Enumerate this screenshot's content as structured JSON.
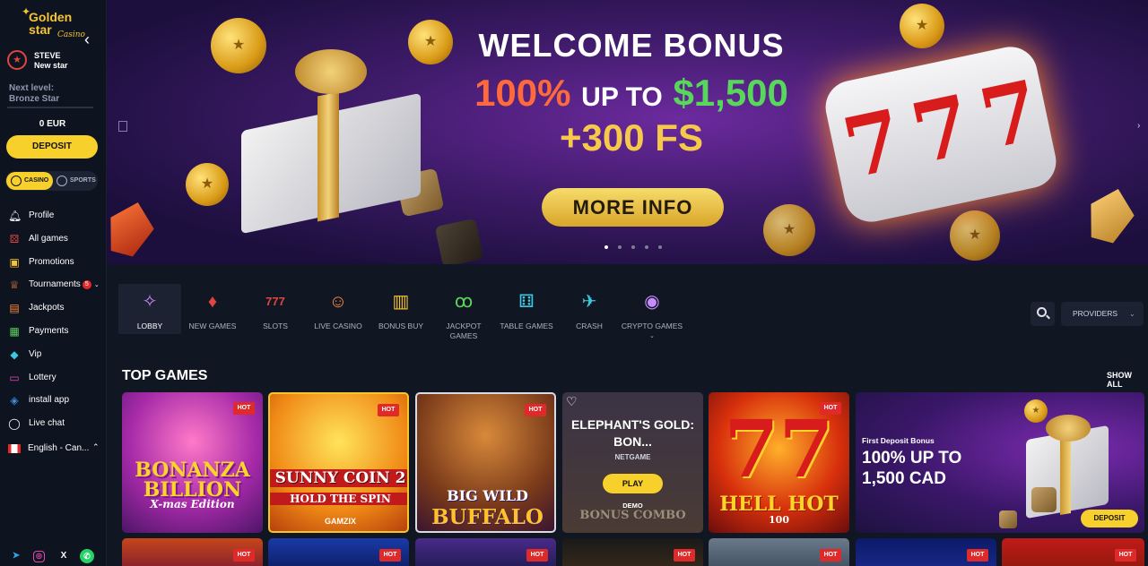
{
  "sidebar": {
    "logo": {
      "line1": "Golden",
      "line2": "star",
      "script": "Casino"
    },
    "user": {
      "name": "STEVE",
      "level": "New star"
    },
    "next_level": {
      "label": "Next level:",
      "value": "Bronze Star",
      "progress_pct": 0
    },
    "balance": "0 EUR",
    "deposit_label": "DEPOSIT",
    "switcher": {
      "casino": "CASINO",
      "sports": "SPORTS"
    },
    "nav": [
      {
        "label": "Profile",
        "icon": "bell-icon"
      },
      {
        "label": "All games",
        "icon": "dice-icon"
      },
      {
        "label": "Promotions",
        "icon": "gift-icon"
      },
      {
        "label": "Tournaments",
        "icon": "trophy-icon",
        "badge": "5"
      },
      {
        "label": "Jackpots",
        "icon": "treasure-icon"
      },
      {
        "label": "Payments",
        "icon": "money-icon"
      },
      {
        "label": "Vip",
        "icon": "diamond-icon"
      },
      {
        "label": "Lottery",
        "icon": "ticket-icon"
      },
      {
        "label": "install app",
        "icon": "android-icon"
      },
      {
        "label": "Live chat",
        "icon": "chat-icon"
      }
    ],
    "language": "English - Can...",
    "socials": [
      "telegram-icon",
      "instagram-icon",
      "x-icon",
      "whatsapp-icon"
    ]
  },
  "banner": {
    "title": "WELCOME BONUS",
    "pct": "100%",
    "up_to": "UP TO",
    "amount": "$1,500",
    "fs": "+300 FS",
    "cta": "MORE INFO",
    "slides": 5,
    "active_slide": 1
  },
  "categories": [
    {
      "label": "LOBBY",
      "icon": "sparkle-icon",
      "color": "#c88cff"
    },
    {
      "label": "NEW GAMES",
      "icon": "cards-icon",
      "color": "#e0463f"
    },
    {
      "label": "SLOTS",
      "icon": "slots-777-icon",
      "color": "#e0463f"
    },
    {
      "label": "LIVE CASINO",
      "icon": "dealer-icon",
      "color": "#ff8a3c"
    },
    {
      "label": "BONUS BUY",
      "icon": "bonus-box-icon",
      "color": "#f5c530"
    },
    {
      "label": "JACKPOT GAMES",
      "icon": "cherry-icon",
      "color": "#5ad35a"
    },
    {
      "label": "TABLE GAMES",
      "icon": "table-dice-icon",
      "color": "#3cc8e0"
    },
    {
      "label": "CRASH",
      "icon": "plane-icon",
      "color": "#3cc8e0"
    },
    {
      "label": "CRYPTO GAMES",
      "icon": "crypto-icon",
      "color": "#c88cff"
    }
  ],
  "providers_label": "PROVIDERS",
  "top_games": {
    "title": "TOP GAMES",
    "show_all": "SHOW ALL",
    "hot_label": "HOT",
    "tiles": [
      {
        "name": "BONANZA BILLION",
        "sub": "X-mas Edition"
      },
      {
        "name": "SUNNY COIN 2",
        "sub": "HOLD THE SPIN",
        "provider": "GAMZIX"
      },
      {
        "name": "BIG WILD",
        "sub": "BUFFALO"
      },
      {
        "title": "ELEPHANT'S GOLD: BON...",
        "provider": "NETGAME",
        "play": "PLAY",
        "demo": "DEMO",
        "bg_text": "BONUS COMBO"
      },
      {
        "name": "HELL HOT",
        "sub": "100"
      }
    ],
    "promo": {
      "sub": "First Deposit Bonus",
      "title": "100% UP TO 1,500 CAD",
      "cta": "DEPOSIT"
    }
  },
  "colors": {
    "accent": "#f7d02b",
    "hot": "#e02a2a",
    "bg": "#111722"
  }
}
